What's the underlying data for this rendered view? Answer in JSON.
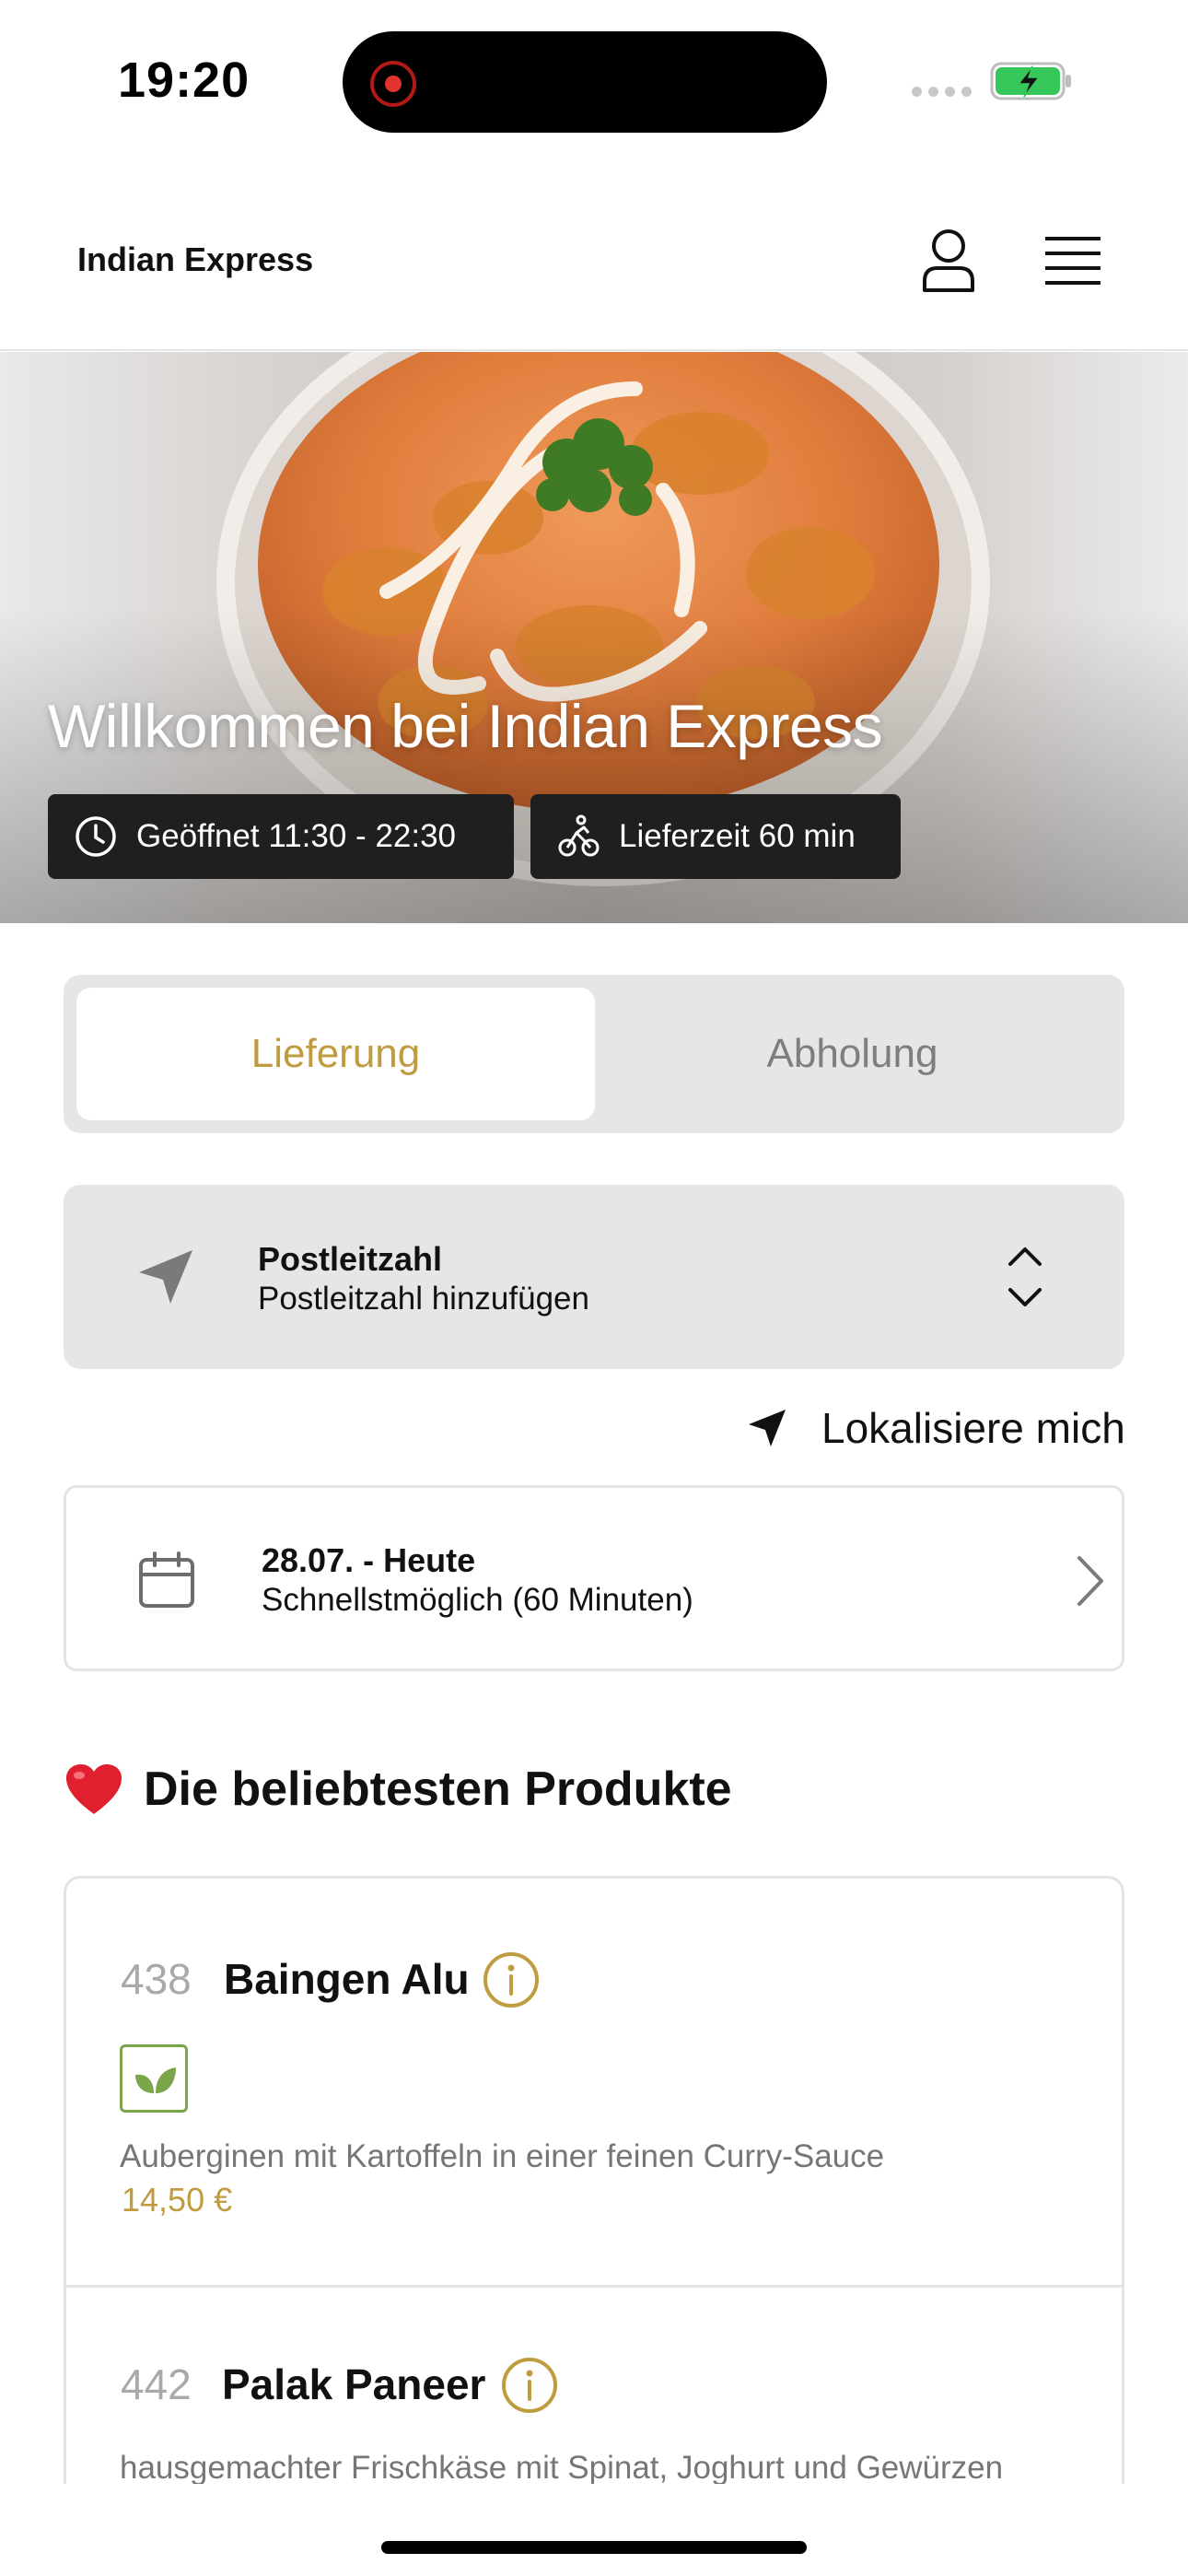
{
  "status_bar": {
    "time": "19:20"
  },
  "header": {
    "title": "Indian Express",
    "user_icon": "user-icon",
    "menu_icon": "menu-icon"
  },
  "hero": {
    "title": "Willkommen bei Indian Express",
    "opening_hours": "Geöffnet 11:30 - 22:30",
    "delivery_time": "Lieferzeit 60 min"
  },
  "mode_toggle": {
    "active": "Lieferung",
    "inactive": "Abholung"
  },
  "postcode": {
    "label": "Postleitzahl",
    "placeholder": "Postleitzahl hinzufügen"
  },
  "locate": {
    "label": "Lokalisiere mich"
  },
  "date": {
    "label": "28.07. - Heute",
    "value": "Schnellstmöglich (60 Minuten)"
  },
  "popular": {
    "title": "Die beliebtesten Produkte",
    "items": [
      {
        "number": "438",
        "name": "Baingen Alu",
        "description": "Auberginen mit Kartoffeln in einer feinen Curry-Sauce",
        "price": "14,50 €",
        "vegetarian": true
      },
      {
        "number": "442",
        "name": "Palak Paneer",
        "description": "hausgemachter Frischkäse mit Spinat, Joghurt und Gewürzen"
      }
    ]
  },
  "colors": {
    "accent": "#bf9c40",
    "pill_bg": "#1f1f1f",
    "panel_bg": "#e6e6e6",
    "veg_green": "#7aa548"
  }
}
